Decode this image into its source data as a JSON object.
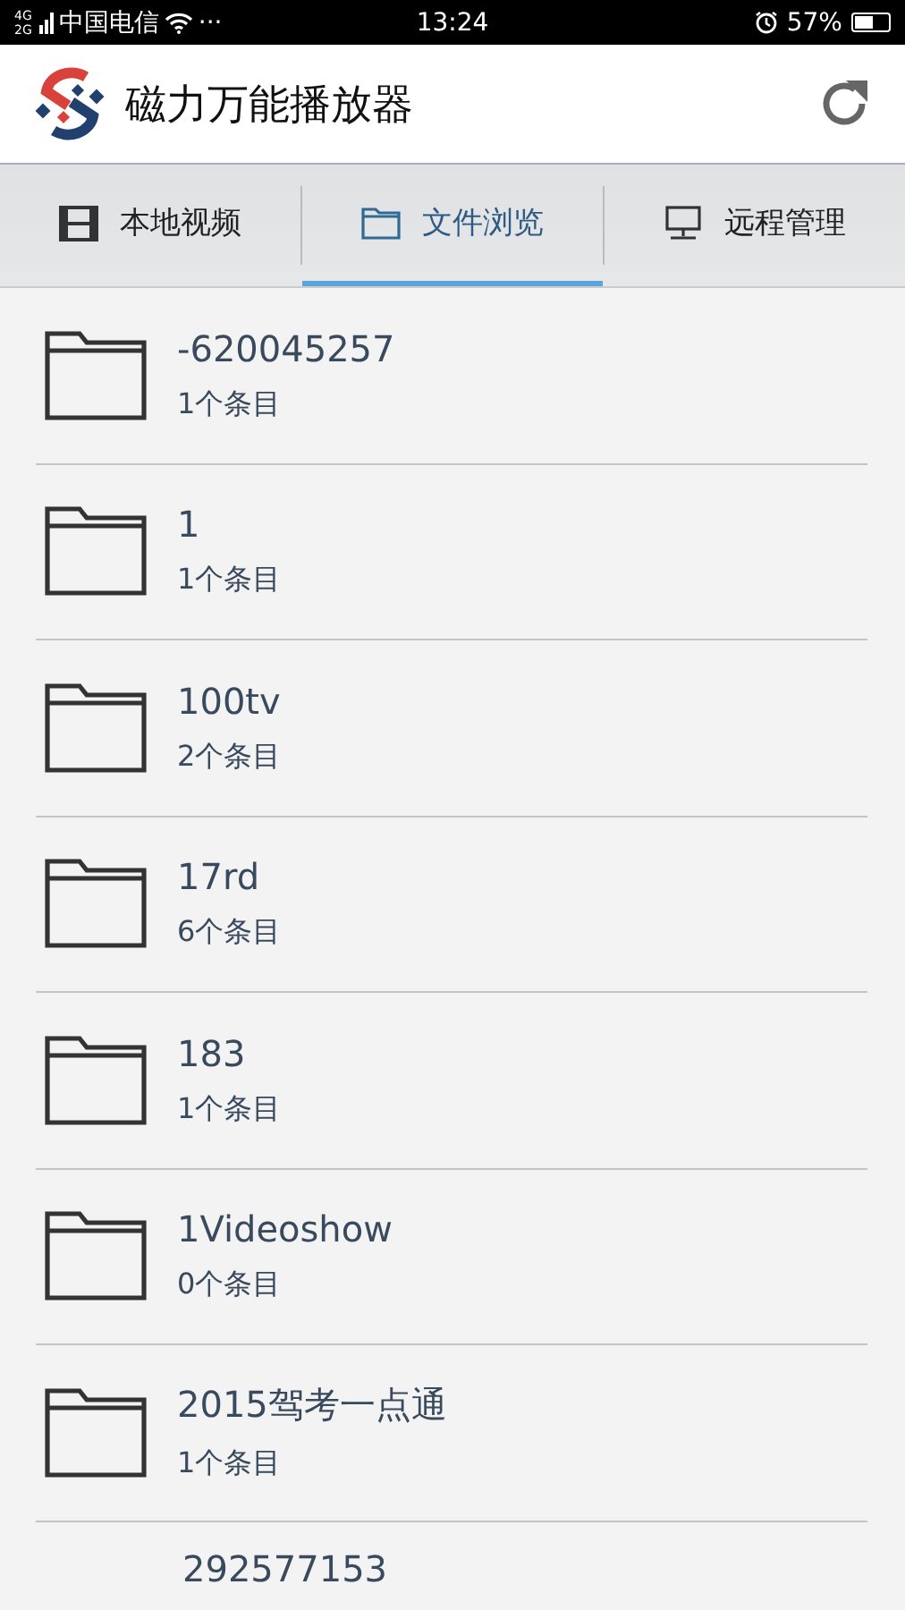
{
  "status_bar": {
    "network": [
      "4G",
      "2G"
    ],
    "carrier": "中国电信",
    "more": "···",
    "time": "13:24",
    "battery": "57%"
  },
  "app_bar": {
    "title": "磁力万能播放器"
  },
  "tabs": [
    {
      "label": "本地视频",
      "kind": "film",
      "selected": false
    },
    {
      "label": "文件浏览",
      "kind": "folder",
      "selected": true
    },
    {
      "label": "远程管理",
      "kind": "monitor",
      "selected": false
    }
  ],
  "folders": [
    {
      "name": "-620045257",
      "count": "1个条目"
    },
    {
      "name": "1",
      "count": "1个条目"
    },
    {
      "name": "100tv",
      "count": "2个条目"
    },
    {
      "name": "17rd",
      "count": "6个条目"
    },
    {
      "name": "183",
      "count": "1个条目"
    },
    {
      "name": "1Videoshow",
      "count": "0个条目"
    },
    {
      "name": "2015驾考一点通",
      "count": "1个条目"
    },
    {
      "name": "292577153"
    }
  ]
}
